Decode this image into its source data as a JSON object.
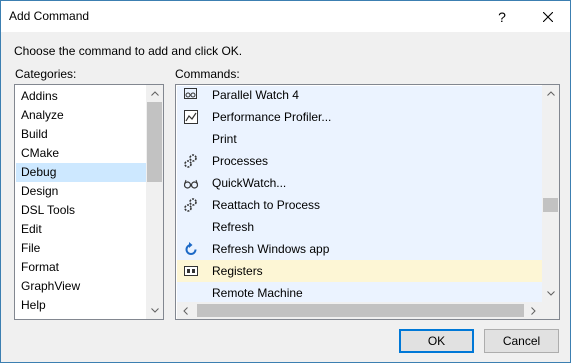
{
  "window": {
    "title": "Add Command"
  },
  "titlebar": {
    "help_glyph": "?",
    "help_icon": "question-icon",
    "close_icon": "close-icon"
  },
  "dialog": {
    "instruction": "Choose the command to add and click OK.",
    "categories_label": "Categories:",
    "commands_label": "Commands:"
  },
  "categories": {
    "selected": "Debug",
    "items": [
      {
        "label": "Addins"
      },
      {
        "label": "Analyze"
      },
      {
        "label": "Build"
      },
      {
        "label": "CMake"
      },
      {
        "label": "Debug"
      },
      {
        "label": "Design"
      },
      {
        "label": "DSL Tools"
      },
      {
        "label": "Edit"
      },
      {
        "label": "File"
      },
      {
        "label": "Format"
      },
      {
        "label": "GraphView"
      },
      {
        "label": "Help"
      }
    ]
  },
  "commands": {
    "highlighted": "Registers",
    "items": [
      {
        "label": "Parallel Watch 4",
        "icon": "parallel-watch-icon"
      },
      {
        "label": "Performance Profiler...",
        "icon": "performance-profiler-icon"
      },
      {
        "label": "Print",
        "icon": ""
      },
      {
        "label": "Processes",
        "icon": "processes-gears-icon"
      },
      {
        "label": "QuickWatch...",
        "icon": "glasses-icon"
      },
      {
        "label": "Reattach to Process",
        "icon": "reattach-gears-icon"
      },
      {
        "label": "Refresh",
        "icon": ""
      },
      {
        "label": "Refresh Windows app",
        "icon": "refresh-icon"
      },
      {
        "label": "Registers",
        "icon": "registers-icon"
      },
      {
        "label": "Remote Machine",
        "icon": ""
      }
    ]
  },
  "buttons": {
    "ok": "OK",
    "cancel": "Cancel"
  },
  "colors": {
    "selected_bg": "#cde8ff",
    "command_area_bg": "#ebf3ff",
    "highlight_bg": "#fdf6d5",
    "accent": "#0078d7",
    "refresh_icon": "#1c69c6"
  }
}
